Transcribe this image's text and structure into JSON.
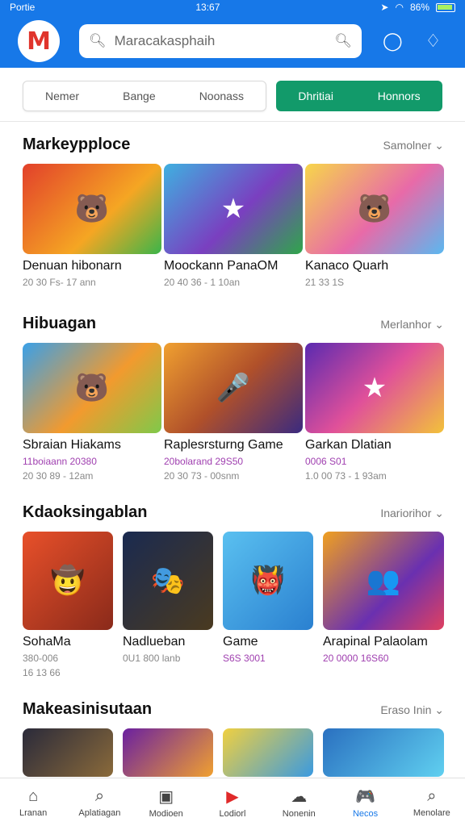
{
  "status": {
    "carrier": "Portie",
    "time": "13:67",
    "battery": "86%"
  },
  "header": {
    "logo": "M",
    "search_placeholder": "Maracakasphaih"
  },
  "filters": {
    "tabs": [
      "Nemer",
      "Bange",
      "Noonass"
    ],
    "active_tabs": [
      "Dhritiai",
      "Honnors"
    ]
  },
  "sections": [
    {
      "title": "Markeypploce",
      "more": "Samolner ⌄",
      "items": [
        {
          "name": "Denuan hibonarn",
          "meta1": "20 30 Fs- 17 ann",
          "meta2": ""
        },
        {
          "name": "Moockann PanaOM",
          "meta1": "20 40 36 - 1 10an",
          "meta2": ""
        },
        {
          "name": "Kanaco Quarh",
          "meta1": "21 33 1S",
          "meta2": ""
        }
      ]
    },
    {
      "title": "Hibuagan",
      "more": "Merlanhor ⌄",
      "items": [
        {
          "name": "Sbraian Hiakams",
          "meta1": "11boiaann 20380",
          "meta2": "20 30 89 - 12am"
        },
        {
          "name": "Raplesrsturng Game",
          "meta1": "20bolarand 29S50",
          "meta2": "20 30 73 - 00snm"
        },
        {
          "name": "Garkan Dlatian",
          "meta1": "0006 S01",
          "meta2": "1.0 00 73 - 1 93am"
        }
      ]
    },
    {
      "title": "Kdaoksingablan",
      "more": "Inariorihor ⌄",
      "items": [
        {
          "name": "SohaMa",
          "meta1": "380-006",
          "meta2": "16 13 66"
        },
        {
          "name": "Nadlueban",
          "meta1": "0U1 800 lanb",
          "meta2": ""
        },
        {
          "name": "Game",
          "meta1": "S6S 3001",
          "meta2": ""
        },
        {
          "name": "Arapinal Palaolam",
          "meta1": "20 0000 16S60",
          "meta2": ""
        }
      ]
    },
    {
      "title": "Makeasinisutaan",
      "more": "Eraso Inin ⌄",
      "items": []
    }
  ],
  "bottom_nav": [
    {
      "label": "Lranan",
      "icon": "home-icon"
    },
    {
      "label": "Aplatiagan",
      "icon": "search-icon"
    },
    {
      "label": "Modioen",
      "icon": "box-icon"
    },
    {
      "label": "Lodiorl",
      "icon": "play-icon"
    },
    {
      "label": "Nonenin",
      "icon": "cloud-icon"
    },
    {
      "label": "Necos",
      "icon": "game-icon",
      "active": true
    },
    {
      "label": "Menolare",
      "icon": "search-icon"
    }
  ]
}
